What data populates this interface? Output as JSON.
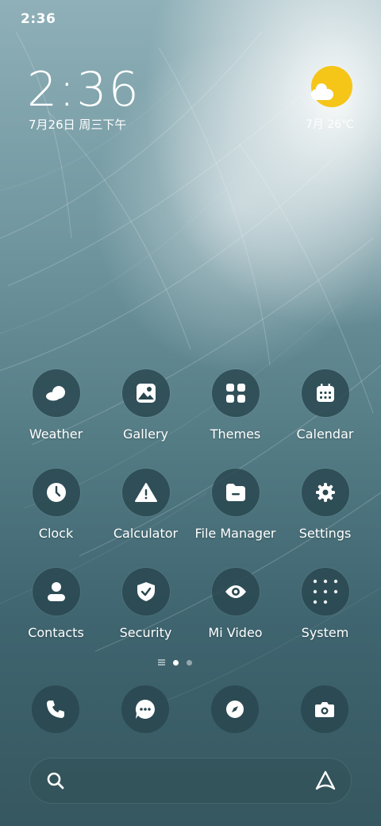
{
  "status_bar": {
    "time": "2:36"
  },
  "clock_widget": {
    "time": "2:36",
    "date": "7月26日 周三下午"
  },
  "weather_widget": {
    "text": "7月 26℃",
    "icon": "sun-cloud-icon"
  },
  "apps": [
    {
      "label": "Weather",
      "icon": "weather-icon"
    },
    {
      "label": "Gallery",
      "icon": "gallery-icon"
    },
    {
      "label": "Themes",
      "icon": "themes-icon"
    },
    {
      "label": "Calendar",
      "icon": "calendar-icon"
    },
    {
      "label": "Clock",
      "icon": "clock-icon"
    },
    {
      "label": "Calculator",
      "icon": "calculator-icon"
    },
    {
      "label": "File Manager",
      "icon": "file-manager-icon"
    },
    {
      "label": "Settings",
      "icon": "settings-icon"
    },
    {
      "label": "Contacts",
      "icon": "contacts-icon"
    },
    {
      "label": "Security",
      "icon": "security-icon"
    },
    {
      "label": "Mi Video",
      "icon": "mi-video-icon"
    },
    {
      "label": "System",
      "icon": "system-folder-icon"
    }
  ],
  "page_indicator": {
    "pages": 2,
    "current": 1
  },
  "dock": [
    {
      "icon": "phone-icon"
    },
    {
      "icon": "messages-icon"
    },
    {
      "icon": "browser-icon"
    },
    {
      "icon": "camera-icon"
    }
  ],
  "search": {
    "placeholder": "",
    "value": ""
  },
  "colors": {
    "icon_bg": "#28464e",
    "sun": "#f5c518",
    "label": "#ffffff"
  }
}
